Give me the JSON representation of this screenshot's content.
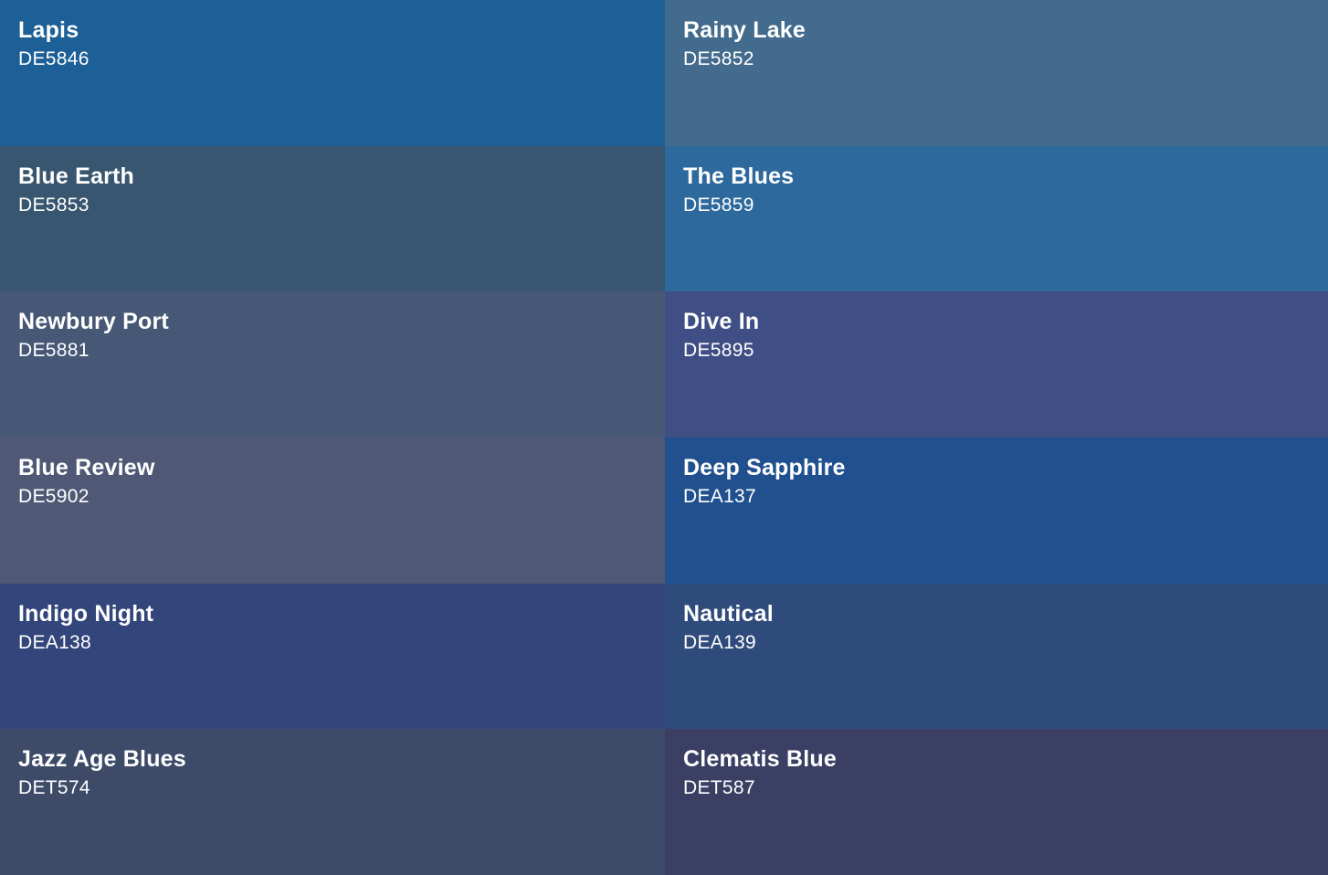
{
  "swatches": [
    {
      "name": "Lapis",
      "code": "DE5846",
      "color": "#1d5f97"
    },
    {
      "name": "Rainy Lake",
      "code": "DE5852",
      "color": "#436b8d"
    },
    {
      "name": "Blue Earth",
      "code": "DE5853",
      "color": "#38566f"
    },
    {
      "name": "The Blues",
      "code": "DE5859",
      "color": "#2d699c"
    },
    {
      "name": "Newbury Port",
      "code": "DE5881",
      "color": "#465876"
    },
    {
      "name": "Dive In",
      "code": "DE5895",
      "color": "#3f4f85"
    },
    {
      "name": "Blue Review",
      "code": "DE5902",
      "color": "#4f5976"
    },
    {
      "name": "Deep Sapphire",
      "code": "DEA137",
      "color": "#21508f"
    },
    {
      "name": "Indigo Night",
      "code": "DEA138",
      "color": "#32467b"
    },
    {
      "name": "Nautical",
      "code": "DEA139",
      "color": "#2f4b7b"
    },
    {
      "name": "Jazz Age Blues",
      "code": "DET574",
      "color": "#3d4b69"
    },
    {
      "name": "Clematis Blue",
      "code": "DET587",
      "color": "#3c3f64"
    }
  ]
}
